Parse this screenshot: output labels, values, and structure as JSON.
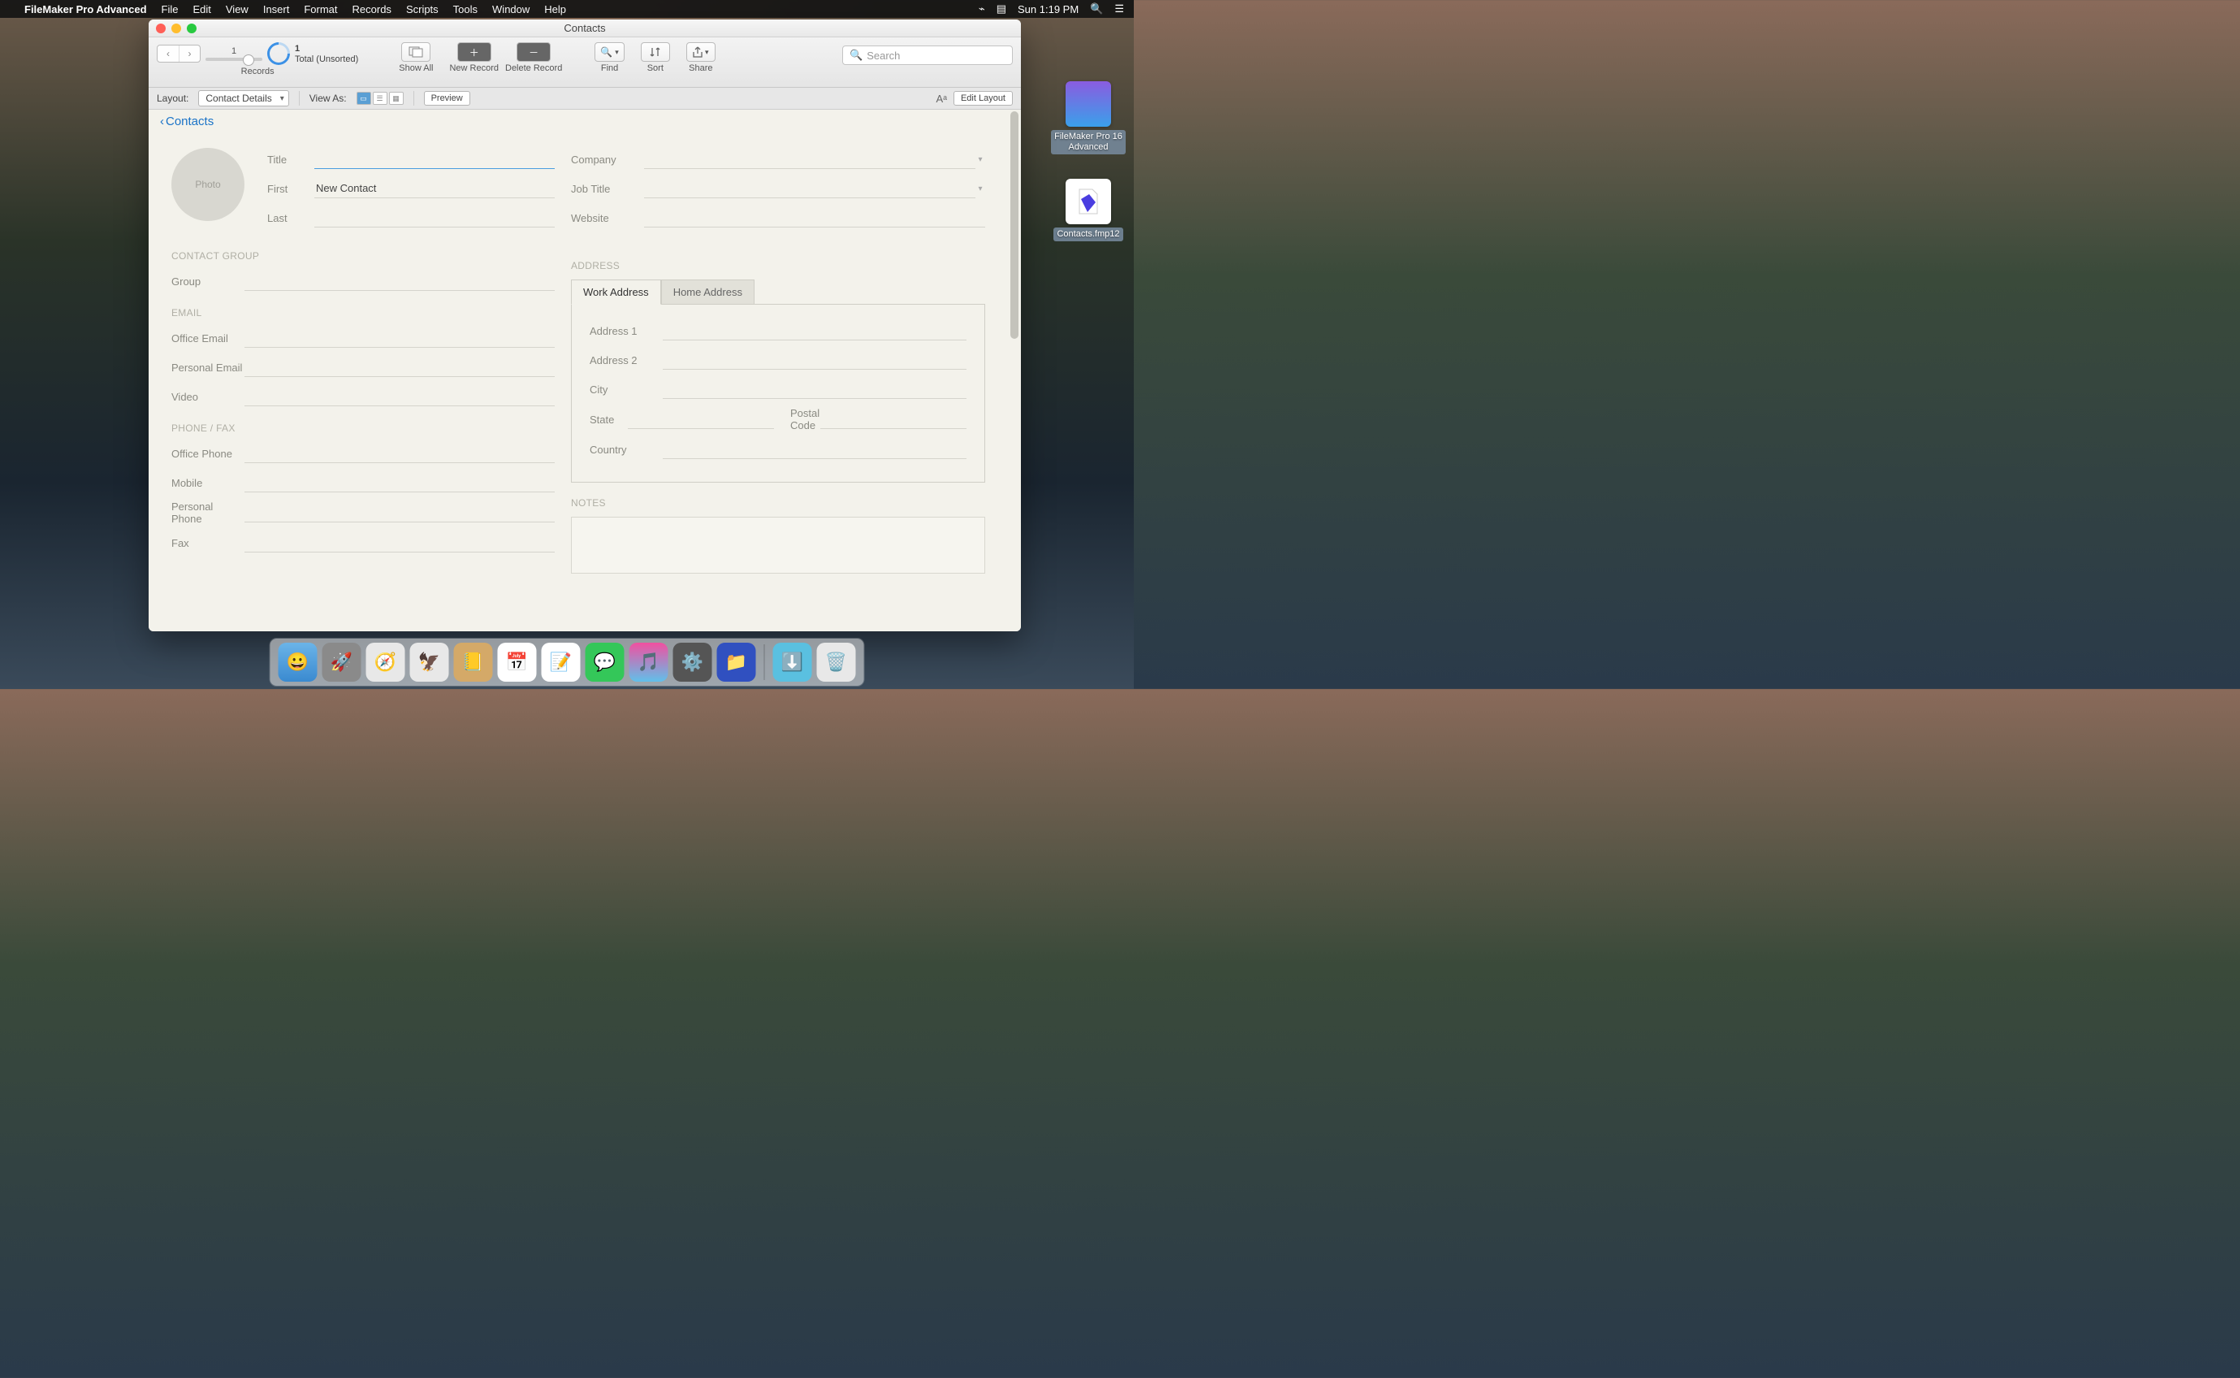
{
  "menubar": {
    "app": "FileMaker Pro Advanced",
    "items": [
      "File",
      "Edit",
      "View",
      "Insert",
      "Format",
      "Records",
      "Scripts",
      "Tools",
      "Window",
      "Help"
    ],
    "clock": "Sun 1:19 PM"
  },
  "window": {
    "title": "Contacts",
    "toolbar": {
      "records_label": "Records",
      "record_num": "1",
      "pie_count": "1",
      "pie_status": "Total (Unsorted)",
      "show_all": "Show All",
      "new_record": "New Record",
      "delete_record": "Delete Record",
      "find": "Find",
      "sort": "Sort",
      "share": "Share",
      "search_placeholder": "Search"
    },
    "layoutbar": {
      "layout_label": "Layout:",
      "layout_value": "Contact Details",
      "view_as": "View As:",
      "preview": "Preview",
      "edit_layout": "Edit Layout"
    },
    "breadcrumb": "Contacts"
  },
  "form": {
    "photo_label": "Photo",
    "identity": {
      "title_label": "Title",
      "title_value": "",
      "first_label": "First",
      "first_value": "New Contact",
      "last_label": "Last",
      "last_value": "",
      "company_label": "Company",
      "company_value": "",
      "jobtitle_label": "Job Title",
      "jobtitle_value": "",
      "website_label": "Website",
      "website_value": ""
    },
    "contact_group_head": "CONTACT GROUP",
    "group_label": "Group",
    "group_value": "",
    "email_head": "EMAIL",
    "office_email_label": "Office Email",
    "office_email_value": "",
    "personal_email_label": "Personal Email",
    "personal_email_value": "",
    "video_label": "Video",
    "video_value": "",
    "phone_head": "PHONE / FAX",
    "office_phone_label": "Office Phone",
    "office_phone_value": "",
    "mobile_label": "Mobile",
    "mobile_value": "",
    "personal_phone_label": "Personal Phone",
    "personal_phone_value": "",
    "fax_label": "Fax",
    "fax_value": "",
    "address_head": "ADDRESS",
    "tab_work": "Work Address",
    "tab_home": "Home Address",
    "address1_label": "Address 1",
    "address1_value": "",
    "address2_label": "Address 2",
    "address2_value": "",
    "city_label": "City",
    "city_value": "",
    "state_label": "State",
    "state_value": "",
    "postal_label": "Postal Code",
    "postal_value": "",
    "country_label": "Country",
    "country_value": "",
    "notes_head": "NOTES"
  },
  "desktop": {
    "icon1": "FileMaker Pro 16 Advanced",
    "icon2": "Contacts.fmp12"
  }
}
